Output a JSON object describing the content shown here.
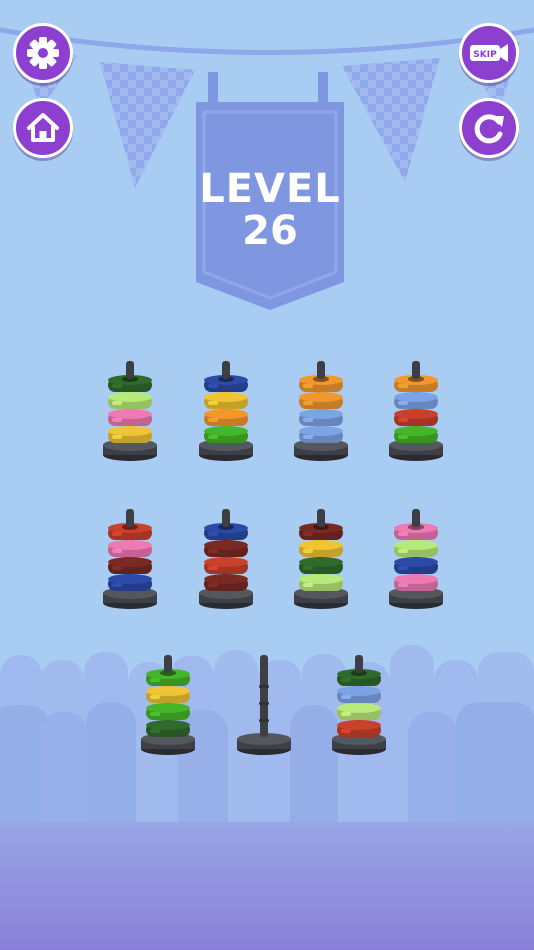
{
  "level": {
    "label": "LEVEL",
    "number": "26"
  },
  "buttons": {
    "settings": {
      "icon": "gear-icon"
    },
    "home": {
      "icon": "home-icon"
    },
    "skip": {
      "icon": "skip-video-icon",
      "label": "SKIP"
    },
    "restart": {
      "icon": "restart-icon"
    }
  },
  "colors": {
    "button_purple": "#8d3fd0",
    "background": "#a9cdf2",
    "floor": "#8f9be3",
    "banner": "#7f97e0",
    "peg": "#3d3f44"
  },
  "ring_colors": {
    "dark_green": "#2f6b2c",
    "light_green": "#b7ea78",
    "pink": "#ee79b3",
    "yellow": "#efc435",
    "navy": "#2c4aa8",
    "green": "#45b52a",
    "orange": "#f2962e",
    "light_blue": "#7da3e6",
    "red": "#c9402b",
    "maroon": "#7a2a22"
  },
  "tubes": [
    {
      "rings": [
        "dark_green",
        "light_green",
        "pink",
        "yellow"
      ]
    },
    {
      "rings": [
        "navy",
        "yellow",
        "orange",
        "green"
      ]
    },
    {
      "rings": [
        "orange",
        "orange",
        "light_blue",
        "light_blue"
      ]
    },
    {
      "rings": [
        "orange",
        "light_blue",
        "red",
        "green"
      ]
    },
    {
      "rings": [
        "red",
        "pink",
        "maroon",
        "navy"
      ]
    },
    {
      "rings": [
        "navy",
        "maroon",
        "red",
        "maroon"
      ]
    },
    {
      "rings": [
        "maroon",
        "yellow",
        "dark_green",
        "light_green"
      ]
    },
    {
      "rings": [
        "pink",
        "light_green",
        "navy",
        "pink"
      ]
    },
    {
      "rings": [
        "green",
        "yellow",
        "green",
        "dark_green"
      ]
    },
    {
      "rings": []
    },
    {
      "rings": [
        "dark_green",
        "light_blue",
        "light_green",
        "red"
      ]
    }
  ]
}
